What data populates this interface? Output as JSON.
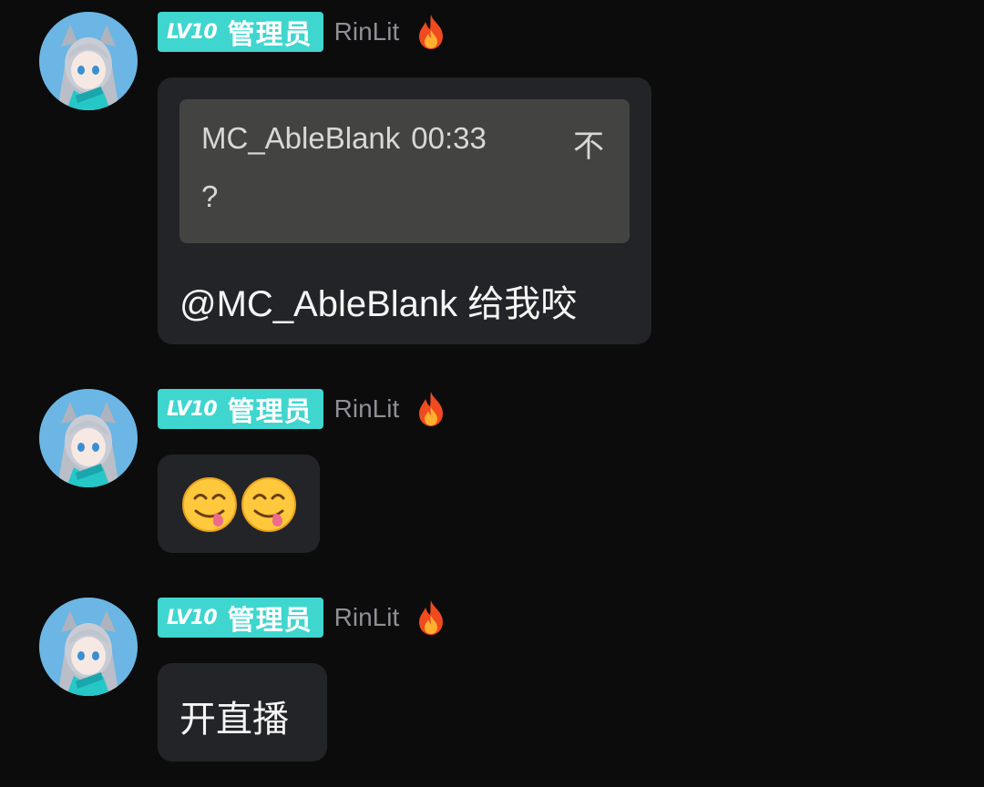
{
  "messages": [
    {
      "badge": {
        "level": "LV10",
        "role": "管理员"
      },
      "username": "RinLit",
      "flame_icon": "fire-icon",
      "reply": {
        "author": "MC_AbleBlank",
        "time": "00:33",
        "right_text": "不",
        "body": "?"
      },
      "text": "@MC_AbleBlank 给我咬"
    },
    {
      "badge": {
        "level": "LV10",
        "role": "管理员"
      },
      "username": "RinLit",
      "flame_icon": "fire-icon",
      "emojis": [
        "face-savoring-food-emoji",
        "face-savoring-food-emoji"
      ]
    },
    {
      "badge": {
        "level": "LV10",
        "role": "管理员"
      },
      "username": "RinLit",
      "flame_icon": "fire-icon",
      "text": "开直播"
    }
  ],
  "colors": {
    "background": "#0c0c0d",
    "bubble": "#232427",
    "quote": "#434442",
    "badge": "#3fd6cf",
    "username": "#8f8f95"
  }
}
